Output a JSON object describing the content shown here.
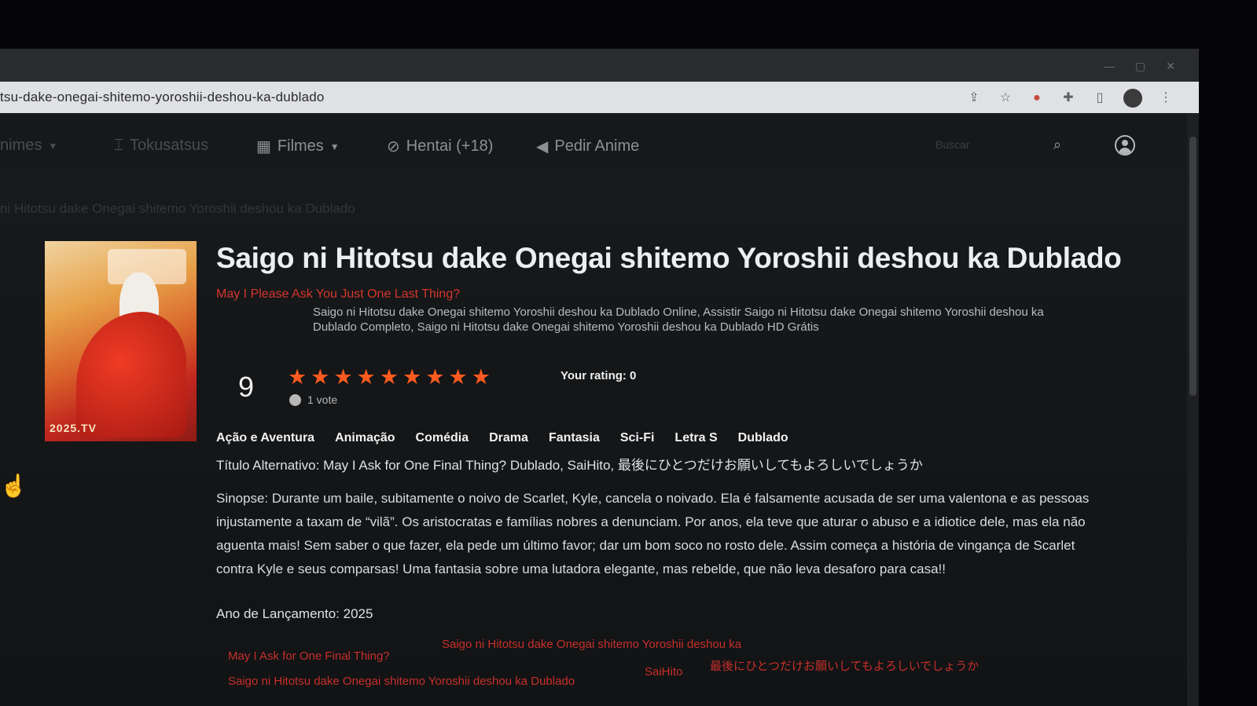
{
  "browser": {
    "url": "tsu-dake-onegai-shitemo-yoroshii-deshou-ka-dublado",
    "icons": [
      "share-icon",
      "star-icon",
      "extension-icon",
      "puzzle-icon",
      "sidepanel-icon",
      "profile-icon",
      "menu-icon"
    ]
  },
  "nav": {
    "items": [
      {
        "label": "nimes",
        "icon": "chevron-down-icon"
      },
      {
        "label": "Tokusatsus",
        "icon": "tokusatsu-icon"
      },
      {
        "label": "Filmes",
        "icon": "film-icon"
      },
      {
        "label": "Hentai (+18)",
        "icon": "no-entry-icon"
      },
      {
        "label": "Pedir Anime",
        "icon": "megaphone-icon"
      }
    ],
    "search_placeholder": "Buscar"
  },
  "breadcrumb": "ni Hitotsu dake Onegai shitemo Yoroshii deshou ka Dublado",
  "anime": {
    "title": "Saigo ni Hitotsu dake Onegai shitemo Yoroshii deshou ka Dublado",
    "english_title": "May I Please Ask You Just One Last Thing?",
    "seo_description": "Saigo ni Hitotsu dake Onegai shitemo Yoroshii deshou ka Dublado Online, Assistir Saigo ni Hitotsu dake Onegai shitemo Yoroshii deshou ka Dublado Completo, Saigo ni Hitotsu dake Onegai shitemo Yoroshii deshou ka Dublado HD Grátis",
    "poster_caption": "2025.TV",
    "rating": {
      "score": "9",
      "stars": 9,
      "votes": "1 vote",
      "your_rating": "Your rating: 0"
    },
    "genres": [
      "Ação e Aventura",
      "Animação",
      "Comédia",
      "Drama",
      "Fantasia",
      "Sci-Fi",
      "Letra S",
      "Dublado"
    ],
    "alternative_title": "Título Alternativo: May I Ask for One Final Thing? Dublado, SaiHito, 最後にひとつだけお願いしてもよろしいでしょうか",
    "synopsis": "Sinopse: Durante um baile, subitamente o noivo de Scarlet, Kyle, cancela o noivado. Ela é falsamente acusada de ser uma valentona e as pessoas injustamente a taxam de “vilã”. Os aristocratas e famílias nobres a denunciam. Por anos, ela teve que aturar o abuso e a idiotice dele, mas ela não aguenta mais! Sem saber o que fazer, ela pede um último favor; dar um bom soco no rosto dele. Assim começa a história de vingança de Scarlet contra Kyle e seus comparsas! Uma fantasia sobre uma lutadora elegante, mas rebelde, que não leva desaforo para casa!!",
    "release_year": "Ano de Lançamento: 2025",
    "tags": [
      "May I Ask for One Final Thing?",
      "Saigo ni Hitotsu dake Onegai shitemo Yoroshii deshou ka",
      "Saigo ni Hitotsu dake Onegai shitemo Yoroshii deshou ka Dublado",
      "SaiHito",
      "最後にひとつだけお願いしてもよろしいでしょうか"
    ]
  },
  "colors": {
    "accent": "#ff5a1f",
    "tag": "#c6302a",
    "background": "#151719"
  }
}
